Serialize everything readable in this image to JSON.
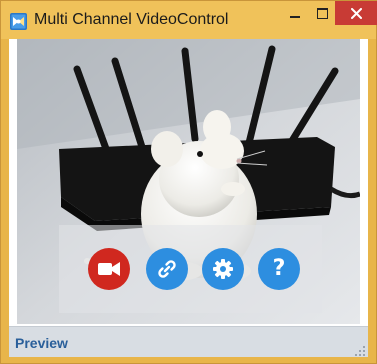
{
  "window": {
    "title": "Multi Channel VideoControl",
    "app_icon": "app-icon",
    "controls": {
      "minimize_icon": "minimize-icon",
      "maximize_icon": "maximize-icon",
      "close_label": "✕"
    }
  },
  "colors": {
    "titlebar": "#f0c25a",
    "close": "#c83b35",
    "record": "#d0281f",
    "action": "#2d8ee0",
    "status_text": "#2a5f9a"
  },
  "preview": {
    "description_icon": "video-preview",
    "buttons": [
      {
        "name": "record",
        "icon": "video-camera-icon"
      },
      {
        "name": "link",
        "icon": "link-icon"
      },
      {
        "name": "settings",
        "icon": "gear-icon"
      },
      {
        "name": "help",
        "icon": "help-icon",
        "glyph": "?"
      }
    ]
  },
  "statusbar": {
    "label": "Preview"
  }
}
